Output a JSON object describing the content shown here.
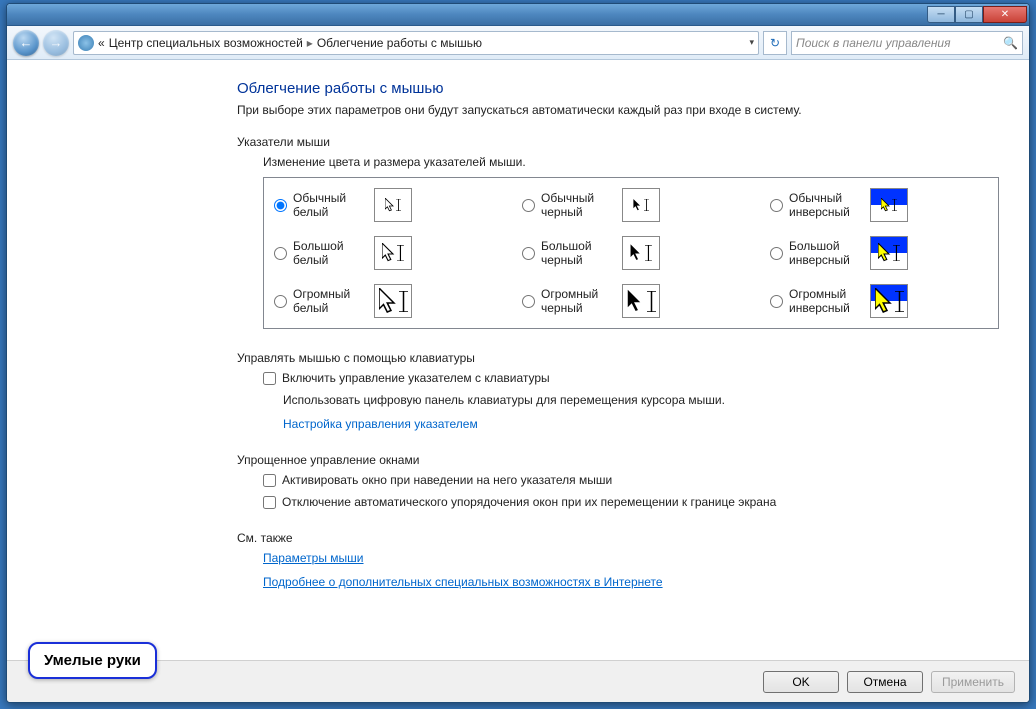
{
  "breadcrumb": {
    "prefix": "«",
    "item1": "Центр специальных возможностей",
    "item2": "Облегчение работы с мышью"
  },
  "search": {
    "placeholder": "Поиск в панели управления"
  },
  "page": {
    "title": "Облегчение работы с мышью",
    "subtitle": "При выборе этих параметров они будут запускаться автоматически каждый раз при входе в систему."
  },
  "pointers": {
    "section": "Указатели мыши",
    "intro": "Изменение цвета и размера указателей мыши.",
    "options": [
      {
        "label": "Обычный белый",
        "type": "white",
        "size": "sm"
      },
      {
        "label": "Обычный черный",
        "type": "black",
        "size": "sm"
      },
      {
        "label": "Обычный инверсный",
        "type": "inv",
        "size": "sm"
      },
      {
        "label": "Большой белый",
        "type": "white",
        "size": "md"
      },
      {
        "label": "Большой черный",
        "type": "black",
        "size": "md"
      },
      {
        "label": "Большой инверсный",
        "type": "inv",
        "size": "md"
      },
      {
        "label": "Огромный белый",
        "type": "white",
        "size": "lg"
      },
      {
        "label": "Огромный черный",
        "type": "black",
        "size": "lg"
      },
      {
        "label": "Огромный инверсный",
        "type": "inv",
        "size": "lg"
      }
    ],
    "selected": 0
  },
  "keyboard": {
    "section": "Управлять мышью с помощью клавиатуры",
    "check": "Включить управление указателем с клавиатуры",
    "desc": "Использовать цифровую панель клавиатуры для перемещения курсора мыши.",
    "link": "Настройка управления указателем"
  },
  "windows": {
    "section": "Упрощенное управление окнами",
    "check1": "Активировать окно при наведении на него указателя мыши",
    "check2": "Отключение автоматического упорядочения окон при их перемещении к границе экрана"
  },
  "seealso": {
    "section": "См. также",
    "link1": "Параметры мыши",
    "link2": "Подробнее о дополнительных специальных возможностях в Интернете"
  },
  "buttons": {
    "ok": "OK",
    "cancel": "Отмена",
    "apply": "Применить"
  },
  "watermark": "Умелые руки"
}
